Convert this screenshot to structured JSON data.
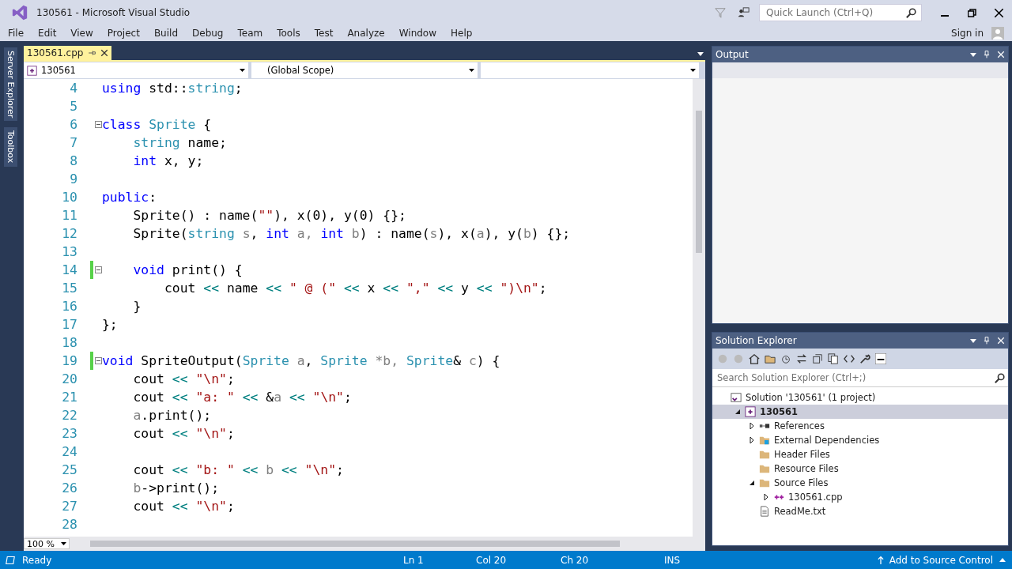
{
  "window": {
    "title": "130561 - Microsoft Visual Studio",
    "quick_launch": {
      "placeholder": "Quick Launch (Ctrl+Q)"
    },
    "sign_in": "Sign in"
  },
  "menu": [
    "File",
    "Edit",
    "View",
    "Project",
    "Build",
    "Debug",
    "Team",
    "Tools",
    "Test",
    "Analyze",
    "Window",
    "Help"
  ],
  "side_tabs": [
    "Server Explorer",
    "Toolbox"
  ],
  "editor": {
    "tabs": [
      {
        "label": "130561.cpp",
        "selected": true
      }
    ],
    "nav": {
      "project": "130561",
      "scope": "(Global Scope)"
    },
    "lines": [
      {
        "num": "4",
        "changed": false,
        "fold": false,
        "tokens": [
          {
            "color": "#0000ff",
            "t": "using"
          },
          {
            "color": "#000000",
            "t": " std::"
          },
          {
            "color": "#2b91af",
            "t": "string"
          },
          {
            "color": "#000000",
            "t": ";"
          }
        ]
      },
      {
        "num": "5",
        "changed": false,
        "fold": false
      },
      {
        "num": "6",
        "changed": false,
        "fold": true,
        "tokens": [
          {
            "color": "#0000ff",
            "t": "class"
          },
          {
            "color": "#2b91af",
            "t": " Sprite"
          },
          {
            "color": "#000000",
            "t": " {"
          }
        ]
      },
      {
        "num": "7",
        "changed": false,
        "fold": false,
        "tokens": [
          {
            "color": "#2b91af",
            "t": "    string"
          },
          {
            "color": "#000000",
            "t": " name;"
          }
        ]
      },
      {
        "num": "8",
        "changed": false,
        "fold": false,
        "tokens": [
          {
            "color": "#0000ff",
            "t": "    int"
          },
          {
            "color": "#000000",
            "t": " x, y;"
          }
        ]
      },
      {
        "num": "9",
        "changed": false,
        "fold": false
      },
      {
        "num": "10",
        "changed": false,
        "fold": false,
        "tokens": [
          {
            "color": "#0000ff",
            "t": "public"
          },
          {
            "color": "#000000",
            "t": ":"
          }
        ]
      },
      {
        "num": "11",
        "changed": false,
        "fold": false,
        "tokens": [
          {
            "color": "#000000",
            "t": "    Sprite() : name("
          },
          {
            "color": "#a31515",
            "t": "\"\""
          },
          {
            "color": "#000000",
            "t": "), x(0), y(0) {};"
          }
        ]
      },
      {
        "num": "12",
        "changed": false,
        "fold": false,
        "tokens": [
          {
            "color": "#000000",
            "t": "    Sprite("
          },
          {
            "color": "#2b91af",
            "t": "string"
          },
          {
            "color": "#808080",
            "t": " s"
          },
          {
            "color": "#000000",
            "t": ", "
          },
          {
            "color": "#0000ff",
            "t": "int"
          },
          {
            "color": "#808080",
            "t": " a, "
          },
          {
            "color": "#0000ff",
            "t": "int"
          },
          {
            "color": "#808080",
            "t": " b"
          },
          {
            "color": "#000000",
            "t": ") : name("
          },
          {
            "color": "#808080",
            "t": "s"
          },
          {
            "color": "#000000",
            "t": "), x("
          },
          {
            "color": "#808080",
            "t": "a"
          },
          {
            "color": "#000000",
            "t": "), y("
          },
          {
            "color": "#808080",
            "t": "b"
          },
          {
            "color": "#000000",
            "t": ") {};"
          }
        ]
      },
      {
        "num": "13",
        "changed": false,
        "fold": false
      },
      {
        "num": "14",
        "changed": true,
        "fold": true,
        "tokens": [
          {
            "color": "#0000ff",
            "t": "    void"
          },
          {
            "color": "#000000",
            "t": " print() {"
          }
        ]
      },
      {
        "num": "15",
        "changed": false,
        "fold": false,
        "tokens": [
          {
            "color": "#000000",
            "t": "        cout "
          },
          {
            "color": "#008080",
            "t": "<<"
          },
          {
            "color": "#000000",
            "t": " name "
          },
          {
            "color": "#008080",
            "t": "<<"
          },
          {
            "color": "#a31515",
            "t": " \" @ (\" "
          },
          {
            "color": "#008080",
            "t": "<<"
          },
          {
            "color": "#000000",
            "t": " x "
          },
          {
            "color": "#008080",
            "t": "<<"
          },
          {
            "color": "#a31515",
            "t": " \",\" "
          },
          {
            "color": "#008080",
            "t": "<<"
          },
          {
            "color": "#000000",
            "t": " y "
          },
          {
            "color": "#008080",
            "t": "<<"
          },
          {
            "color": "#a31515",
            "t": " \")\\n\""
          },
          {
            "color": "#000000",
            "t": ";"
          }
        ]
      },
      {
        "num": "16",
        "changed": false,
        "fold": false,
        "tokens": [
          {
            "color": "#000000",
            "t": "    }"
          }
        ]
      },
      {
        "num": "17",
        "changed": false,
        "fold": false,
        "tokens": [
          {
            "color": "#000000",
            "t": "};"
          }
        ]
      },
      {
        "num": "18",
        "changed": false,
        "fold": false
      },
      {
        "num": "19",
        "changed": true,
        "fold": true,
        "tokens": [
          {
            "color": "#0000ff",
            "t": "void"
          },
          {
            "color": "#000000",
            "t": " SpriteOutput("
          },
          {
            "color": "#2b91af",
            "t": "Sprite"
          },
          {
            "color": "#808080",
            "t": " a"
          },
          {
            "color": "#000000",
            "t": ", "
          },
          {
            "color": "#2b91af",
            "t": "Sprite"
          },
          {
            "color": "#808080",
            "t": " *b, "
          },
          {
            "color": "#2b91af",
            "t": "Sprite"
          },
          {
            "color": "#000000",
            "t": "& "
          },
          {
            "color": "#808080",
            "t": "c"
          },
          {
            "color": "#000000",
            "t": ") {"
          }
        ]
      },
      {
        "num": "20",
        "changed": false,
        "fold": false,
        "tokens": [
          {
            "color": "#000000",
            "t": "    cout "
          },
          {
            "color": "#008080",
            "t": "<<"
          },
          {
            "color": "#a31515",
            "t": " \"\\n\""
          },
          {
            "color": "#000000",
            "t": ";"
          }
        ]
      },
      {
        "num": "21",
        "changed": false,
        "fold": false,
        "tokens": [
          {
            "color": "#000000",
            "t": "    cout "
          },
          {
            "color": "#008080",
            "t": "<<"
          },
          {
            "color": "#a31515",
            "t": " \"a: \" "
          },
          {
            "color": "#008080",
            "t": "<<"
          },
          {
            "color": "#000000",
            "t": " &"
          },
          {
            "color": "#808080",
            "t": "a "
          },
          {
            "color": "#008080",
            "t": "<<"
          },
          {
            "color": "#a31515",
            "t": " \"\\n\""
          },
          {
            "color": "#000000",
            "t": ";"
          }
        ]
      },
      {
        "num": "22",
        "changed": false,
        "fold": false,
        "tokens": [
          {
            "color": "#808080",
            "t": "    a"
          },
          {
            "color": "#000000",
            "t": ".print();"
          }
        ]
      },
      {
        "num": "23",
        "changed": false,
        "fold": false,
        "tokens": [
          {
            "color": "#000000",
            "t": "    cout "
          },
          {
            "color": "#008080",
            "t": "<<"
          },
          {
            "color": "#a31515",
            "t": " \"\\n\""
          },
          {
            "color": "#000000",
            "t": ";"
          }
        ]
      },
      {
        "num": "24",
        "changed": false,
        "fold": false
      },
      {
        "num": "25",
        "changed": false,
        "fold": false,
        "tokens": [
          {
            "color": "#000000",
            "t": "    cout "
          },
          {
            "color": "#008080",
            "t": "<<"
          },
          {
            "color": "#a31515",
            "t": " \"b: \" "
          },
          {
            "color": "#008080",
            "t": "<<"
          },
          {
            "color": "#808080",
            "t": " b "
          },
          {
            "color": "#008080",
            "t": "<<"
          },
          {
            "color": "#a31515",
            "t": " \"\\n\""
          },
          {
            "color": "#000000",
            "t": ";"
          }
        ]
      },
      {
        "num": "26",
        "changed": false,
        "fold": false,
        "tokens": [
          {
            "color": "#808080",
            "t": "    b"
          },
          {
            "color": "#000000",
            "t": "->print();"
          }
        ]
      },
      {
        "num": "27",
        "changed": false,
        "fold": false,
        "tokens": [
          {
            "color": "#000000",
            "t": "    cout "
          },
          {
            "color": "#008080",
            "t": "<<"
          },
          {
            "color": "#a31515",
            "t": " \"\\n\""
          },
          {
            "color": "#000000",
            "t": ";"
          }
        ]
      },
      {
        "num": "28",
        "changed": false,
        "fold": false
      }
    ],
    "zoom": "100 %"
  },
  "output": {
    "title": "Output"
  },
  "solution_explorer": {
    "title": "Solution Explorer",
    "search": {
      "placeholder": "Search Solution Explorer (Ctrl+;)"
    },
    "tree": [
      {
        "kind": "solution",
        "label": "Solution '130561' (1 project)",
        "selected": false,
        "children": [
          {
            "kind": "project",
            "label": "130561",
            "selected": true,
            "expanded": true,
            "children": [
              {
                "kind": "references",
                "label": "References",
                "selected": false,
                "expanded": false
              },
              {
                "kind": "external",
                "label": "External Dependencies",
                "selected": false,
                "expanded": false
              },
              {
                "kind": "folder",
                "label": "Header Files",
                "selected": false
              },
              {
                "kind": "folder",
                "label": "Resource Files",
                "selected": false
              },
              {
                "kind": "folder",
                "label": "Source Files",
                "selected": false,
                "expanded": true,
                "children": [
                  {
                    "kind": "cpp",
                    "label": "130561.cpp",
                    "selected": false,
                    "expanded": false
                  }
                ]
              },
              {
                "kind": "text",
                "label": "ReadMe.txt",
                "selected": false
              }
            ]
          }
        ]
      }
    ]
  },
  "status_bar": {
    "state": "Ready",
    "line": "Ln 1",
    "col": "Col 20",
    "ch": "Ch 20",
    "mode": "INS",
    "source_control": "Add to Source Control"
  }
}
